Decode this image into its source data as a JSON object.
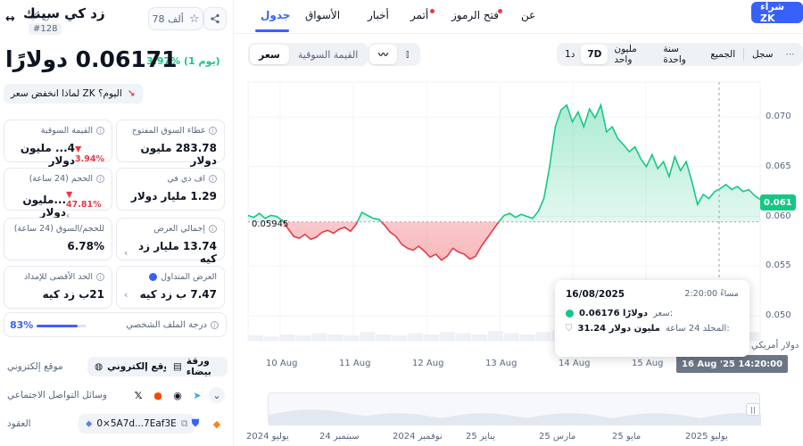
{
  "coin": {
    "name": "زد كي سينك",
    "symbol": "زد كيه",
    "rank": "#128",
    "watchlist_count": "78 ألف",
    "price": "0.06171 دولارًا",
    "change": "3.97% (1 يوم)",
    "why_text": "لماذا انخفض سعر ZK اليوم؟"
  },
  "stats": [
    {
      "label": "القيمة السوقية",
      "value": "4... مليون دولار",
      "sub": "3.94%",
      "chev": false
    },
    {
      "label": "غطاء السوق المفتوح",
      "value": "283.78 مليون دولار",
      "sub": "",
      "chev": false
    },
    {
      "label": "الحجم (24 ساعة)",
      "value": "...مليون دولار",
      "sub": "47.81%",
      "chev": true
    },
    {
      "label": "اف دي في",
      "value": "1.29 مليار دولار",
      "sub": "",
      "chev": false
    },
    {
      "label": "للحجم/السوق (24 ساعة)",
      "value": "6.78%",
      "sub": "",
      "chev": false
    },
    {
      "label": "إجمالي العرض",
      "value": "13.74 مليار زد كيه",
      "sub": "",
      "chev": true
    },
    {
      "label": "الحد الأقصى للإمداد",
      "value": "21ب زد كيه",
      "sub": "",
      "chev": false
    },
    {
      "label": "العرض المتداول",
      "value": "7.47 ب زد كيه",
      "sub": "",
      "chev": true
    }
  ],
  "profile": {
    "label": "درجة الملف الشخصي",
    "percent": "83%",
    "fill": 0.83
  },
  "links": {
    "website_label": "موقع إلكتروني",
    "website_btn": "موقع إلكتروني",
    "whitepaper_btn": "ورقة بيضاء",
    "social_label": "وسائل التواصل الاجتماعي",
    "contracts_label": "العقود",
    "contract_address": "0×5A7d...7Eaf3E"
  },
  "tabs": [
    {
      "label": "جدول",
      "active": true,
      "dot": false
    },
    {
      "label": "الأسواق",
      "active": false,
      "dot": false
    },
    {
      "label": "أخبار",
      "active": false,
      "dot": false
    },
    {
      "label": "أتمر",
      "active": false,
      "dot": true
    },
    {
      "label": "فتح الرموز",
      "active": false,
      "dot": true
    },
    {
      "label": "عن",
      "active": false,
      "dot": false
    }
  ],
  "buy_button": "شراء ZK",
  "view_toggle": {
    "price": "سعر",
    "market_cap": "القيمة السوقية"
  },
  "time_ranges": [
    "1د",
    "7D",
    "مليون واحد",
    "سنة واحدة",
    "الجميع",
    "سجل"
  ],
  "selected_range": "7D",
  "tooltip": {
    "date": "16/08/2025",
    "time": "2:20:00 مساءً",
    "price_label": "سعر:",
    "price_value": "0.06176 دولارًا",
    "volume_label": "المجلد 24 ساعة:",
    "volume_value": "31.24 مليون دولار"
  },
  "current_price_tag": "0.061",
  "crosshair_time": "16 Aug '25 14:20:00",
  "currency_label": "دولار أمريكي",
  "reference_label": "0.05945",
  "nav_labels": [
    "يوليو 2024",
    "سبتمبر 24",
    "نوفمبر 2024",
    "يناير 25",
    "مارس 25",
    "مايو 25",
    "يوليو 2025"
  ],
  "chart_data": {
    "type": "area",
    "x_ticks": [
      "10 Aug",
      "11 Aug",
      "12 Aug",
      "13 Aug",
      "14 Aug",
      "15 Aug"
    ],
    "y_ticks": [
      0.07,
      0.065,
      0.06,
      0.055,
      0.05
    ],
    "ylim": [
      0.0475,
      0.0735
    ],
    "baseline": 0.05945,
    "values": [
      0.0601,
      0.0599,
      0.0603,
      0.0598,
      0.0601,
      0.06,
      0.0596,
      0.0588,
      0.058,
      0.0578,
      0.0582,
      0.0577,
      0.0579,
      0.0584,
      0.0586,
      0.0583,
      0.0587,
      0.0589,
      0.0585,
      0.0592,
      0.0604,
      0.0601,
      0.0598,
      0.0597,
      0.0591,
      0.0584,
      0.058,
      0.0572,
      0.0568,
      0.0566,
      0.057,
      0.0565,
      0.0559,
      0.0562,
      0.0556,
      0.056,
      0.0568,
      0.0564,
      0.0562,
      0.0557,
      0.056,
      0.057,
      0.0578,
      0.0586,
      0.0594,
      0.0601,
      0.0603,
      0.0599,
      0.0602,
      0.06,
      0.0598,
      0.0605,
      0.0618,
      0.065,
      0.069,
      0.0707,
      0.0712,
      0.0695,
      0.0705,
      0.069,
      0.0708,
      0.0699,
      0.0712,
      0.0685,
      0.069,
      0.0678,
      0.0672,
      0.0665,
      0.067,
      0.0658,
      0.065,
      0.0662,
      0.0648,
      0.0655,
      0.064,
      0.066,
      0.0646,
      0.0655,
      0.0635,
      0.0612,
      0.0622,
      0.0618,
      0.0625,
      0.0628,
      0.0632,
      0.0627,
      0.063,
      0.0625,
      0.0627,
      0.0621,
      0.0617
    ]
  },
  "volume_data": [
    0.05,
    0.04,
    0.06,
    0.05,
    0.07,
    0.06,
    0.05,
    0.08,
    0.06,
    0.05,
    0.07,
    0.06,
    0.08,
    0.07,
    0.06,
    0.09,
    0.07,
    0.06,
    0.08,
    0.1,
    0.22,
    0.2,
    0.15,
    0.12,
    0.14,
    0.11,
    0.09,
    0.1,
    0.08,
    0.07,
    0.06,
    0.08
  ]
}
